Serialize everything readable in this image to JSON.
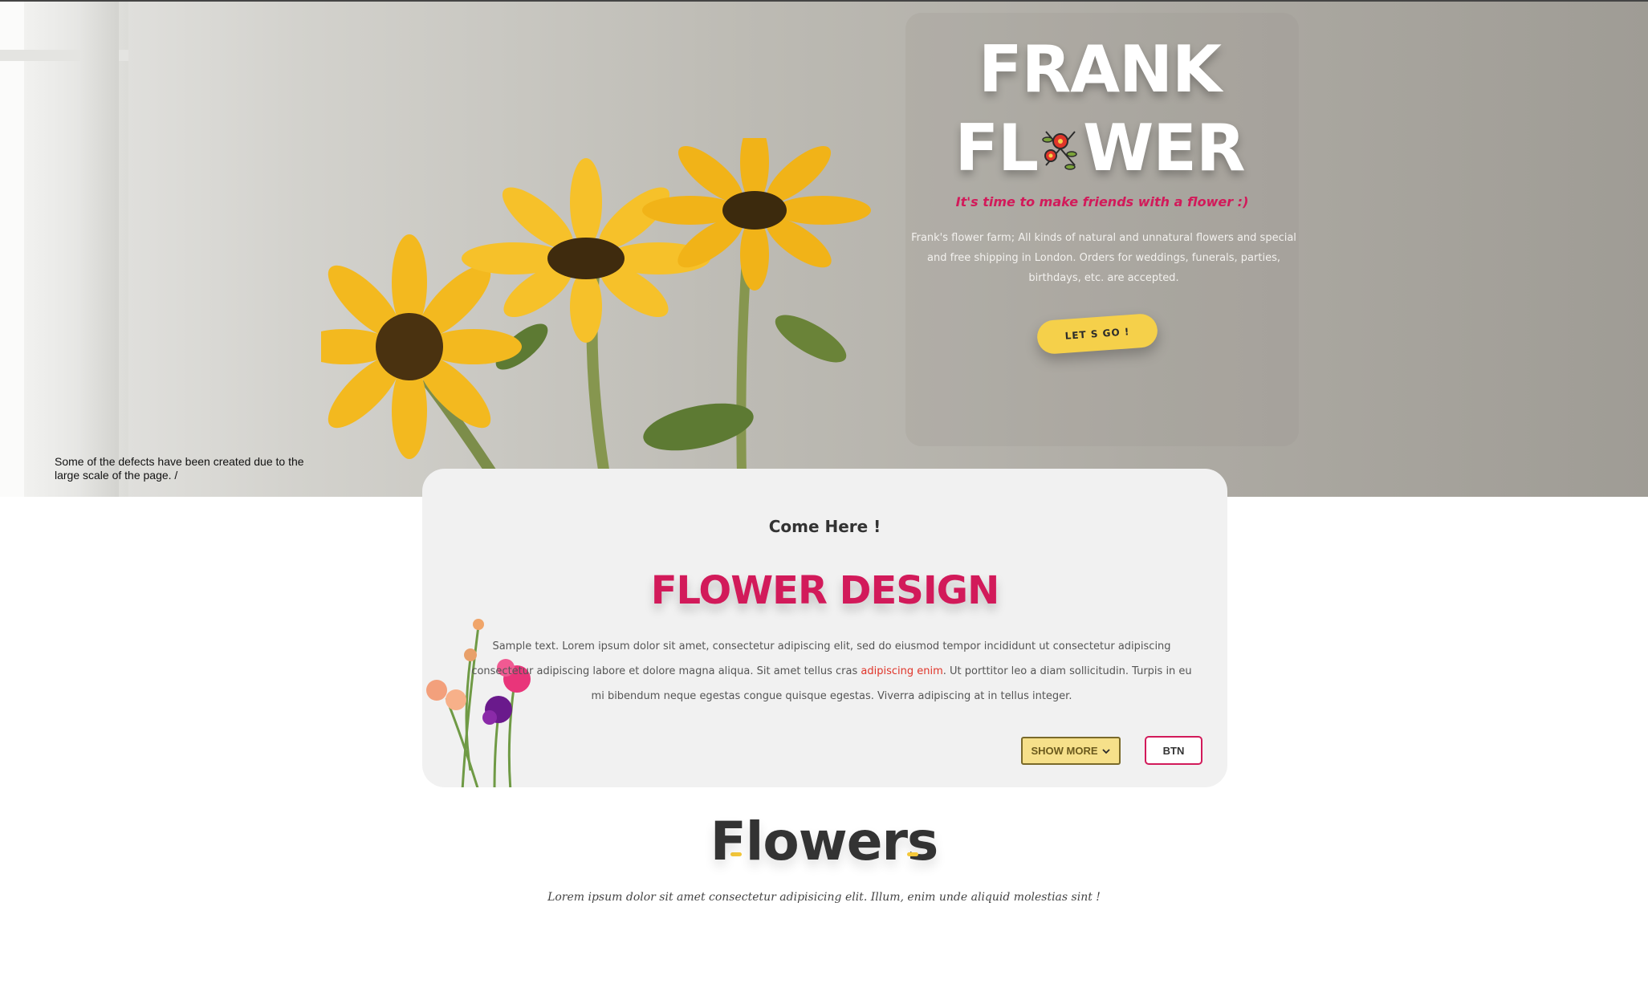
{
  "hero": {
    "brand_line1": "FRANK",
    "brand_line2_prefix": "FL",
    "brand_line2_suffix": "WER",
    "tagline": "It's time to make friends with a flower :)",
    "description": "Frank's flower farm; All kinds of natural and unnatural flowers and special and free shipping in London. Orders for weddings, funerals, parties, birthdays, etc. are accepted.",
    "cta_label": "LET S GO !",
    "defect_note": "Some of the defects have been created due to the large scale of the page. /"
  },
  "card": {
    "eyebrow": "Come Here !",
    "title": "FLOWER DESIGN",
    "text_before": "Sample text. Lorem ipsum dolor sit amet, consectetur adipiscing elit, sed do eiusmod tempor incididunt ut consectetur adipiscing consectetur adipiscing labore et dolore magna aliqua. Sit amet tellus cras ",
    "text_highlight": "adipiscing enim",
    "text_after": ". Ut porttitor leo a diam sollicitudin. Turpis in eu mi bibendum neque egestas congue quisque egestas. Viverra adipiscing at in tellus integer.",
    "show_more_label": "SHOW MORE",
    "btn_label": "BTN"
  },
  "flowers_section": {
    "title": "Flowers",
    "subtitle": "Lorem ipsum dolor sit amet consectetur adipisicing elit. Illum, enim unde aliquid molestias sint !"
  },
  "colors": {
    "accent_pink": "#d21a5a",
    "accent_yellow": "#f5d04a",
    "highlight_red": "#e0352a"
  },
  "icons": {
    "brand_o": "flower-ornament-icon",
    "show_more": "chevron-down-icon"
  }
}
